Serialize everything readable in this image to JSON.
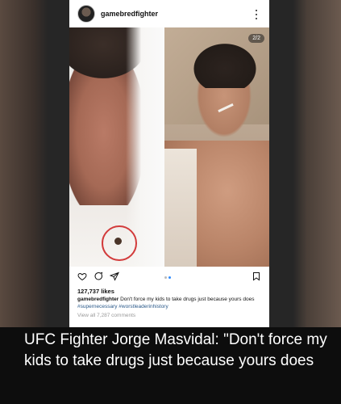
{
  "post": {
    "username": "gamebredfighter",
    "counter": "2/2",
    "likes": "127,737 likes",
    "caption_user": "gamebredfighter",
    "caption_text": " Don't force my kids to take drugs just because yours does ",
    "caption_tags": "#supernecessary #worstleaderinhistory",
    "view_all": "View all 7,287 comments"
  },
  "icons": {
    "more": "more-vertical-icon",
    "heart": "heart-icon",
    "comment": "comment-icon",
    "share": "send-icon",
    "bookmark": "bookmark-icon"
  },
  "headline": "UFC Fighter Jorge Masvidal: \"Don't force my kids to take drugs just because yours does",
  "colors": {
    "background": "#0d0d0d",
    "circle_marker": "#d23b3b",
    "hashtag": "#2b5a8a",
    "active_dot": "#2f8cff"
  }
}
